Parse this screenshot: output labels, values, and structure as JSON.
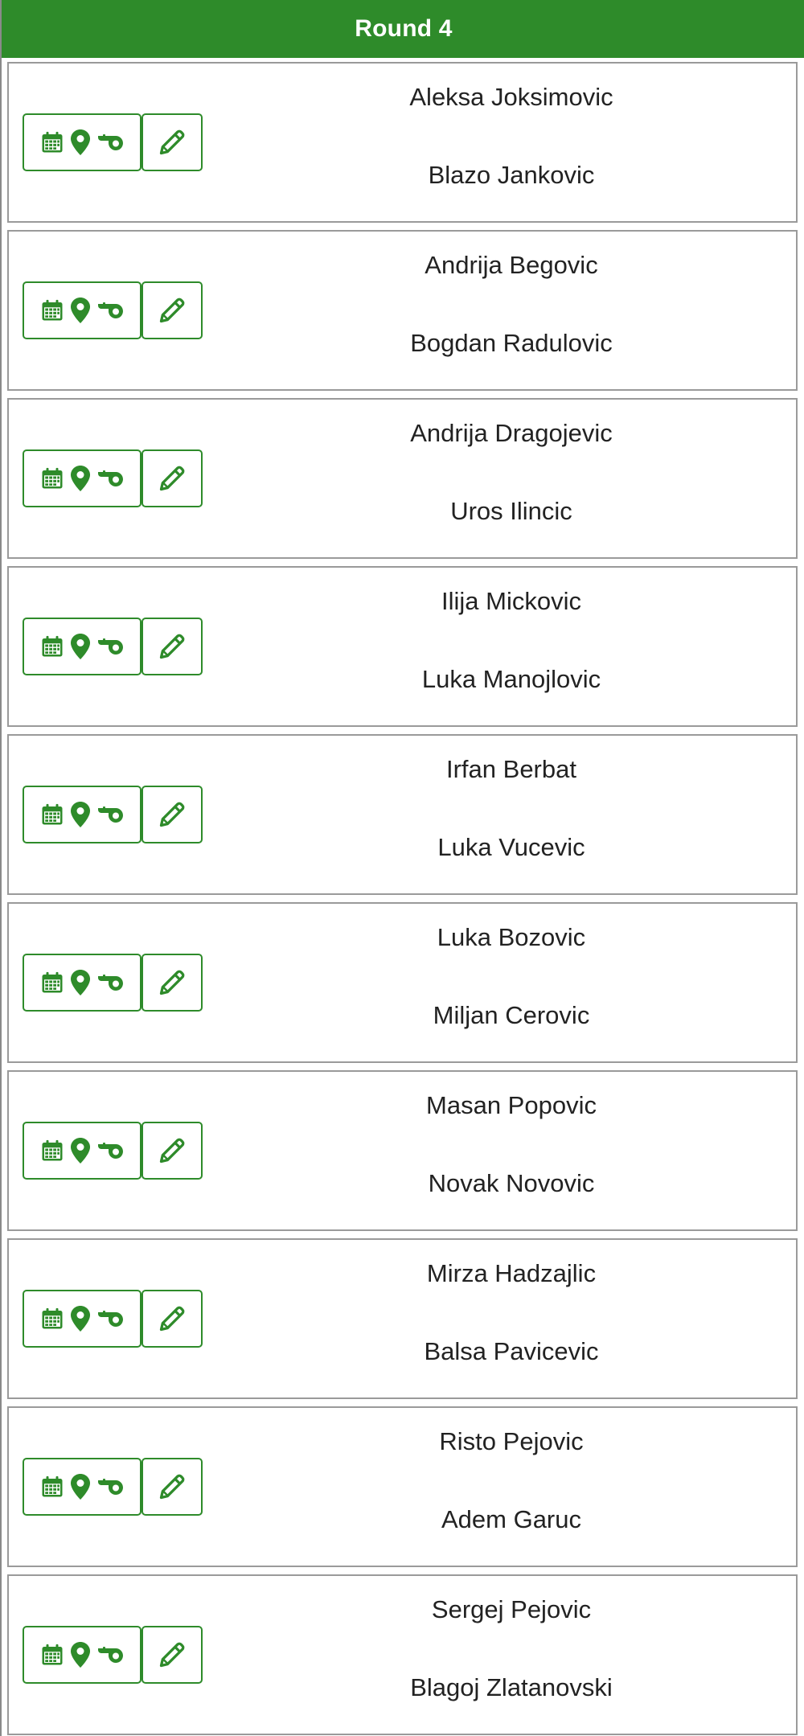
{
  "round": {
    "title": "Round 4"
  },
  "colors": {
    "accent": "#2e8b2a",
    "card_border": "#9a9a9a",
    "text": "#222222"
  },
  "icons": {
    "schedule": "calendar-icon",
    "venue": "map-marker-icon",
    "referee": "whistle-icon",
    "edit": "pencil-icon"
  },
  "matches": [
    {
      "home": "Aleksa Joksimovic",
      "away": "Blazo Jankovic"
    },
    {
      "home": "Andrija Begovic",
      "away": "Bogdan Radulovic"
    },
    {
      "home": "Andrija Dragojevic",
      "away": "Uros Ilincic"
    },
    {
      "home": "Ilija Mickovic",
      "away": "Luka Manojlovic"
    },
    {
      "home": "Irfan Berbat",
      "away": "Luka Vucevic"
    },
    {
      "home": "Luka Bozovic",
      "away": "Miljan Cerovic"
    },
    {
      "home": "Masan Popovic",
      "away": "Novak Novovic"
    },
    {
      "home": "Mirza Hadzajlic",
      "away": "Balsa Pavicevic"
    },
    {
      "home": "Risto Pejovic",
      "away": "Adem Garuc"
    },
    {
      "home": "Sergej Pejovic",
      "away": "Blagoj Zlatanovski"
    }
  ]
}
